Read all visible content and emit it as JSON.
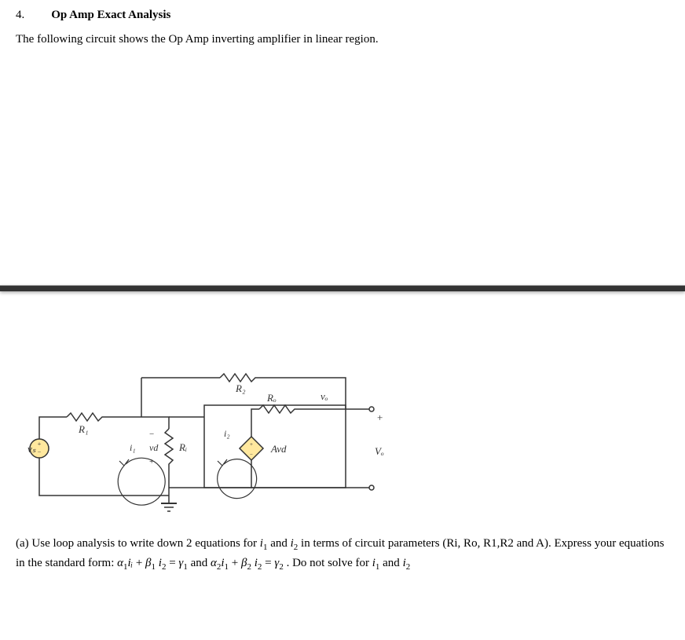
{
  "header": {
    "number": "4.",
    "title": "Op Amp Exact Analysis"
  },
  "description": "The following circuit shows the Op Amp inverting amplifier in linear region.",
  "circuit_labels": {
    "vs": "vₛ",
    "r1": "R₁",
    "i1": "i₁",
    "vd": "vd",
    "ri": "Rᵢ",
    "r2": "R₂",
    "i2": "i₂",
    "ro": "Rₒ",
    "avd": "Avd",
    "vo_ital": "vₒ",
    "vo_cap": "Vₒ",
    "plus": "+",
    "minus": "−"
  },
  "question": {
    "part_label": "(a) Use loop analysis to write down 2 equations for ",
    "i1": "i",
    "sub1": "1",
    "and1": " and ",
    "i2": "i",
    "sub2": "2",
    "text2": " in terms of circuit parameters (Ri, Ro, R1,R2 and A). Express your equations in the standard form: ",
    "alpha1": "α",
    "sub_a1": "1",
    "i_a": "iᵢ",
    "plus1": " + ",
    "beta1": "β",
    "sub_b1": "1",
    "space1": " ",
    "i2_a": "i",
    "sub2_a": "2",
    "eq1": " = ",
    "gamma1": "γ",
    "sub_g1": "1",
    "and2": " and ",
    "alpha2": "α",
    "sub_a2": "2",
    "i1_b": "i",
    "sub1_b": "1",
    "plus2": " + ",
    "beta2": "β",
    "sub_b2": "2",
    "space2": " ",
    "i2_b": "i",
    "sub2_b": "2",
    "eq2": " = ",
    "gamma2": "γ",
    "sub_g2": "2",
    "text3": " . Do not solve for ",
    "i1_c": "i",
    "sub1_c": "1",
    "and3": " and ",
    "i2_c": "i",
    "sub2_c": "2"
  }
}
